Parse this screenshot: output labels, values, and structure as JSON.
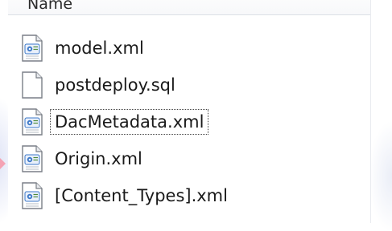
{
  "column": {
    "header_label": "Name"
  },
  "files": [
    {
      "name": "model.xml",
      "icon": "xml-file-icon"
    },
    {
      "name": "postdeploy.sql",
      "icon": "blank-file-icon"
    },
    {
      "name": "DacMetadata.xml",
      "icon": "xml-file-icon",
      "focused": true
    },
    {
      "name": "Origin.xml",
      "icon": "xml-file-icon"
    },
    {
      "name": "[Content_Types].xml",
      "icon": "xml-file-icon"
    }
  ],
  "colors": {
    "accent_blue": "#3c78c8",
    "focus_outline": "#444444"
  }
}
